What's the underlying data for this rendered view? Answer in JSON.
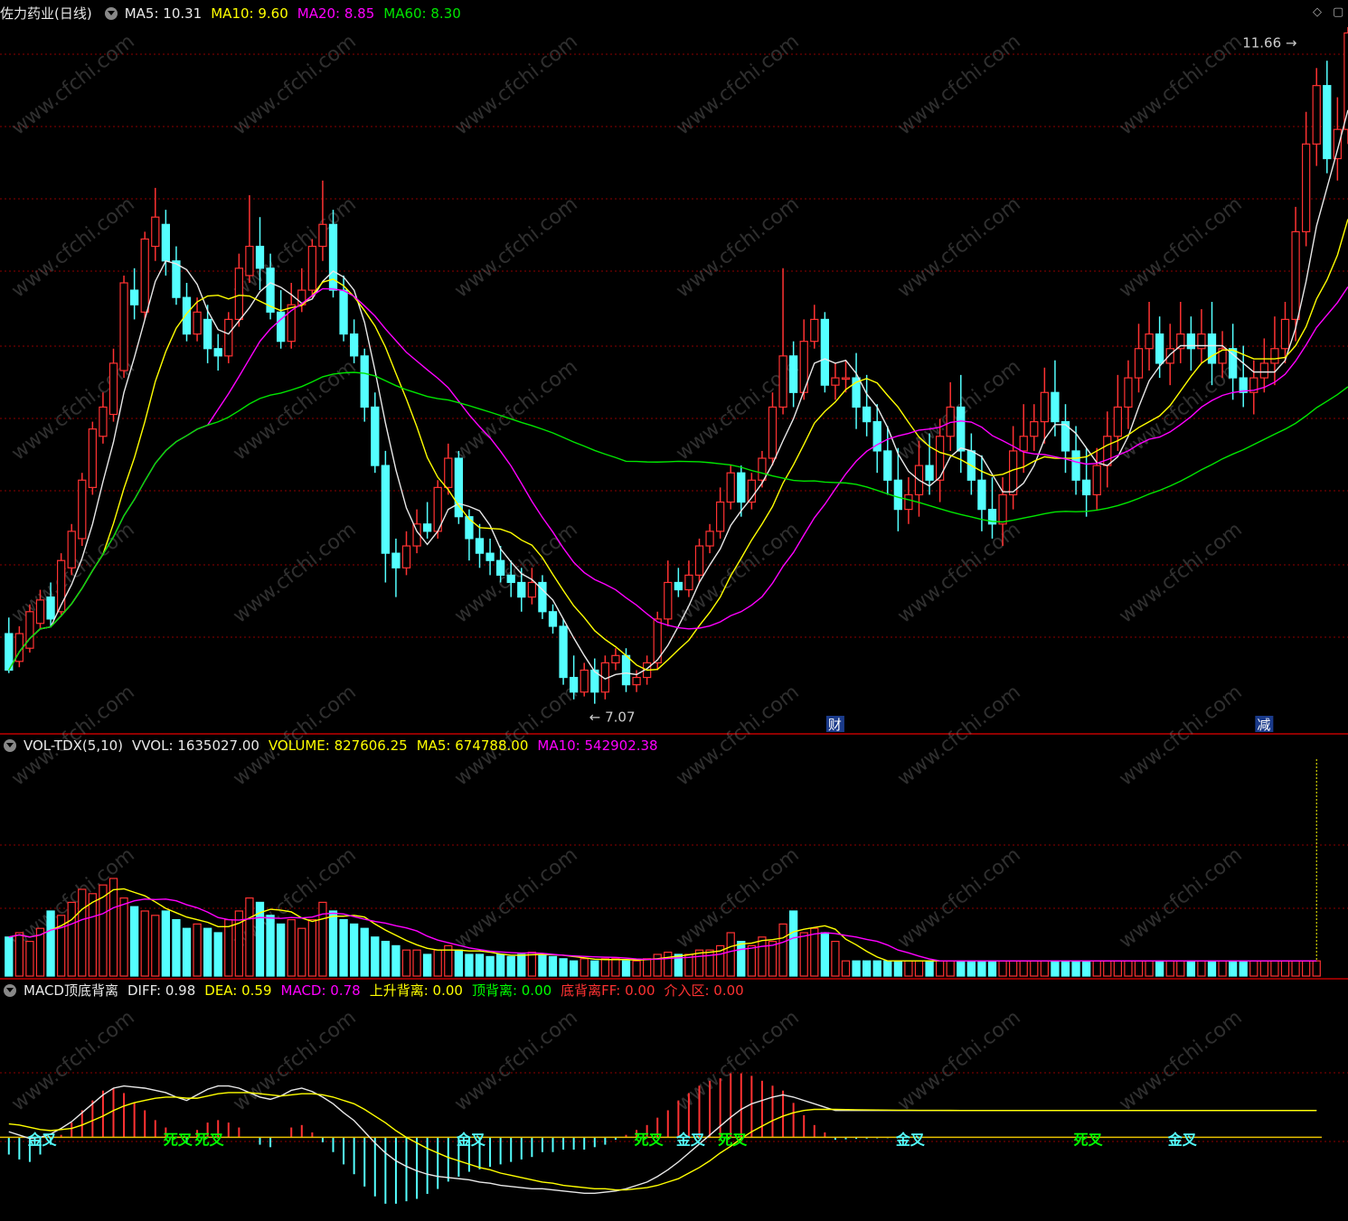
{
  "colors": {
    "up": "#ff3232",
    "down": "#54ffff",
    "ma5": "#e8e8e8",
    "ma10": "#ffff00",
    "ma20": "#ff00ff",
    "ma60": "#00e600",
    "grid": "#8b0000",
    "white": "#e8e8e8",
    "yellow": "#ffff00",
    "magenta": "#ff00ff",
    "green": "#00e600",
    "red": "#ff3232",
    "cyan": "#54ffff",
    "label_gold": "#e8c000",
    "label_cyan": "#54ffff",
    "label_green": "#00ff00"
  },
  "price_header": {
    "title": "佐力药业(日线)",
    "ma5": "MA5: 10.31",
    "ma10": "MA10: 9.60",
    "ma20": "MA20: 8.85",
    "ma60": "MA60: 8.30"
  },
  "vol_header": {
    "name": "VOL-TDX(5,10)",
    "vvol": "VVOL: 1635027.00",
    "volume": "VOLUME: 827606.25",
    "ma5": "MA5: 674788.00",
    "ma10": "MA10: 542902.38"
  },
  "macd_header": {
    "name": "MACD顶底背离",
    "diff": "DIFF: 0.98",
    "dea": "DEA: 0.59",
    "macd": "MACD: 0.78",
    "up_div": "上升背离: 0.00",
    "top_div": "顶背离: 0.00",
    "bottom_div": "底背离FF: 0.00",
    "entry": "介入区: 0.00"
  },
  "corner_icons": [
    "diamond-icon",
    "window-icon"
  ],
  "watermark": "www.cfchi.com",
  "chart_data": {
    "type": "candlestick",
    "x": "trading day index (0-125)",
    "price_range": [
      7.0,
      11.7
    ],
    "high_marker": "11.66",
    "low_marker": "7.07",
    "high_marker_value": 11.66,
    "low_marker_value": 7.07,
    "event_markers": [
      {
        "label": "财",
        "day": 79
      },
      {
        "label": "减",
        "day": 120
      }
    ],
    "candles": [
      [
        7.55,
        7.3,
        7.66,
        7.28
      ],
      [
        7.36,
        7.55,
        7.6,
        7.32
      ],
      [
        7.45,
        7.7,
        7.75,
        7.42
      ],
      [
        7.62,
        7.78,
        7.85,
        7.58
      ],
      [
        7.8,
        7.65,
        7.9,
        7.6
      ],
      [
        7.7,
        8.05,
        8.1,
        7.68
      ],
      [
        8.0,
        8.25,
        8.3,
        7.95
      ],
      [
        8.2,
        8.6,
        8.65,
        8.15
      ],
      [
        8.55,
        8.95,
        9.0,
        8.5
      ],
      [
        8.9,
        9.1,
        9.2,
        8.85
      ],
      [
        9.05,
        9.4,
        9.5,
        9.0
      ],
      [
        9.35,
        9.95,
        10.0,
        9.3
      ],
      [
        9.9,
        9.8,
        10.05,
        9.7
      ],
      [
        9.75,
        10.25,
        10.3,
        9.7
      ],
      [
        10.2,
        10.4,
        10.6,
        10.1
      ],
      [
        10.35,
        10.1,
        10.45,
        10.0
      ],
      [
        10.1,
        9.85,
        10.2,
        9.8
      ],
      [
        9.85,
        9.6,
        9.95,
        9.55
      ],
      [
        9.6,
        9.75,
        9.85,
        9.55
      ],
      [
        9.7,
        9.5,
        9.8,
        9.4
      ],
      [
        9.5,
        9.45,
        9.6,
        9.35
      ],
      [
        9.45,
        9.7,
        9.75,
        9.4
      ],
      [
        9.7,
        10.05,
        10.15,
        9.65
      ],
      [
        10.0,
        10.2,
        10.55,
        9.95
      ],
      [
        10.2,
        10.05,
        10.4,
        9.9
      ],
      [
        10.05,
        9.75,
        10.15,
        9.7
      ],
      [
        9.75,
        9.55,
        9.9,
        9.5
      ],
      [
        9.55,
        9.8,
        9.95,
        9.5
      ],
      [
        9.8,
        9.9,
        10.05,
        9.75
      ],
      [
        9.9,
        10.2,
        10.25,
        9.85
      ],
      [
        10.2,
        10.35,
        10.65,
        10.1
      ],
      [
        10.35,
        9.9,
        10.45,
        9.85
      ],
      [
        9.9,
        9.6,
        10.0,
        9.55
      ],
      [
        9.6,
        9.45,
        9.7,
        9.4
      ],
      [
        9.45,
        9.1,
        9.5,
        9.0
      ],
      [
        9.1,
        8.7,
        9.2,
        8.65
      ],
      [
        8.7,
        8.1,
        8.8,
        7.9
      ],
      [
        8.1,
        8.0,
        8.2,
        7.8
      ],
      [
        8.0,
        8.15,
        8.25,
        7.95
      ],
      [
        8.15,
        8.3,
        8.4,
        8.1
      ],
      [
        8.3,
        8.25,
        8.45,
        8.2
      ],
      [
        8.25,
        8.55,
        8.6,
        8.2
      ],
      [
        8.55,
        8.75,
        8.85,
        8.5
      ],
      [
        8.75,
        8.35,
        8.8,
        8.3
      ],
      [
        8.35,
        8.2,
        8.4,
        8.05
      ],
      [
        8.2,
        8.1,
        8.3,
        8.0
      ],
      [
        8.1,
        8.05,
        8.2,
        7.95
      ],
      [
        8.05,
        7.95,
        8.15,
        7.9
      ],
      [
        7.95,
        7.9,
        8.05,
        7.8
      ],
      [
        7.9,
        7.8,
        8.0,
        7.7
      ],
      [
        7.8,
        7.9,
        8.0,
        7.75
      ],
      [
        7.9,
        7.7,
        7.95,
        7.65
      ],
      [
        7.7,
        7.6,
        7.75,
        7.55
      ],
      [
        7.6,
        7.25,
        7.65,
        7.2
      ],
      [
        7.25,
        7.15,
        7.4,
        7.1
      ],
      [
        7.15,
        7.3,
        7.35,
        7.12
      ],
      [
        7.3,
        7.15,
        7.38,
        7.07
      ],
      [
        7.15,
        7.35,
        7.4,
        7.1
      ],
      [
        7.35,
        7.4,
        7.45,
        7.3
      ],
      [
        7.4,
        7.2,
        7.45,
        7.15
      ],
      [
        7.2,
        7.25,
        7.3,
        7.15
      ],
      [
        7.25,
        7.35,
        7.4,
        7.2
      ],
      [
        7.35,
        7.65,
        7.7,
        7.3
      ],
      [
        7.65,
        7.9,
        8.05,
        7.6
      ],
      [
        7.9,
        7.85,
        8.0,
        7.8
      ],
      [
        7.85,
        7.95,
        8.05,
        7.8
      ],
      [
        7.95,
        8.15,
        8.2,
        7.9
      ],
      [
        8.15,
        8.25,
        8.3,
        8.1
      ],
      [
        8.25,
        8.45,
        8.55,
        8.2
      ],
      [
        8.45,
        8.65,
        8.7,
        8.4
      ],
      [
        8.65,
        8.45,
        8.7,
        8.35
      ],
      [
        8.45,
        8.6,
        8.65,
        8.4
      ],
      [
        8.6,
        8.75,
        8.8,
        8.55
      ],
      [
        8.75,
        9.1,
        9.2,
        8.7
      ],
      [
        9.1,
        9.45,
        10.05,
        9.05
      ],
      [
        9.45,
        9.2,
        9.55,
        9.1
      ],
      [
        9.2,
        9.55,
        9.7,
        9.15
      ],
      [
        9.55,
        9.7,
        9.8,
        9.5
      ],
      [
        9.7,
        9.25,
        9.75,
        9.2
      ],
      [
        9.25,
        9.3,
        9.4,
        9.15
      ]
    ],
    "volume": [
      0.18,
      0.2,
      0.16,
      0.22,
      0.3,
      0.28,
      0.34,
      0.4,
      0.38,
      0.42,
      0.45,
      0.36,
      0.32,
      0.3,
      0.28,
      0.3,
      0.26,
      0.22,
      0.24,
      0.22,
      0.2,
      0.26,
      0.3,
      0.36,
      0.34,
      0.28,
      0.24,
      0.26,
      0.22,
      0.26,
      0.34,
      0.3,
      0.26,
      0.24,
      0.22,
      0.18,
      0.16,
      0.14,
      0.12,
      0.12,
      0.1,
      0.12,
      0.14,
      0.12,
      0.1,
      0.1,
      0.09,
      0.1,
      0.09,
      0.1,
      0.11,
      0.1,
      0.09,
      0.08,
      0.07,
      0.08,
      0.07,
      0.08,
      0.08,
      0.07,
      0.07,
      0.08,
      0.1,
      0.11,
      0.1,
      0.1,
      0.12,
      0.12,
      0.14,
      0.2,
      0.16,
      0.14,
      0.18,
      0.16,
      0.24,
      0.3,
      0.2,
      0.22,
      0.2,
      0.16
    ],
    "macd_range": [
      -0.7,
      1.2
    ],
    "diff": [
      0.05,
      0.02,
      -0.01,
      0.0,
      0.03,
      0.08,
      0.14,
      0.22,
      0.3,
      0.38,
      0.44,
      0.46,
      0.45,
      0.44,
      0.42,
      0.4,
      0.36,
      0.33,
      0.38,
      0.43,
      0.46,
      0.46,
      0.44,
      0.4,
      0.36,
      0.34,
      0.37,
      0.42,
      0.44,
      0.41,
      0.36,
      0.3,
      0.22,
      0.15,
      0.05,
      -0.05,
      -0.14,
      -0.21,
      -0.26,
      -0.3,
      -0.33,
      -0.35,
      -0.36,
      -0.37,
      -0.38,
      -0.4,
      -0.41,
      -0.43,
      -0.44,
      -0.45,
      -0.46,
      -0.46,
      -0.47,
      -0.48,
      -0.49,
      -0.5,
      -0.5,
      -0.49,
      -0.48,
      -0.46,
      -0.43,
      -0.4,
      -0.35,
      -0.29,
      -0.22,
      -0.14,
      -0.06,
      0.02,
      0.1,
      0.18,
      0.25,
      0.3,
      0.33,
      0.36,
      0.38,
      0.36,
      0.33,
      0.3,
      0.27,
      0.24
    ],
    "dea": [
      0.12,
      0.11,
      0.09,
      0.07,
      0.06,
      0.07,
      0.08,
      0.11,
      0.15,
      0.19,
      0.24,
      0.28,
      0.31,
      0.33,
      0.35,
      0.36,
      0.36,
      0.35,
      0.35,
      0.37,
      0.39,
      0.4,
      0.4,
      0.4,
      0.39,
      0.38,
      0.37,
      0.38,
      0.39,
      0.39,
      0.38,
      0.36,
      0.33,
      0.3,
      0.25,
      0.19,
      0.13,
      0.06,
      0.0,
      -0.05,
      -0.1,
      -0.14,
      -0.18,
      -0.21,
      -0.24,
      -0.27,
      -0.29,
      -0.32,
      -0.34,
      -0.36,
      -0.38,
      -0.4,
      -0.41,
      -0.43,
      -0.44,
      -0.45,
      -0.46,
      -0.46,
      -0.47,
      -0.47,
      -0.46,
      -0.45,
      -0.43,
      -0.4,
      -0.37,
      -0.32,
      -0.27,
      -0.21,
      -0.14,
      -0.08,
      -0.01,
      0.05,
      0.1,
      0.15,
      0.19,
      0.22,
      0.24,
      0.25,
      0.25,
      0.25
    ],
    "macd_labels": [
      {
        "label": "金叉",
        "day": 3,
        "color": "cyan"
      },
      {
        "label": "死叉",
        "day": 16,
        "color": "green"
      },
      {
        "label": "死叉",
        "day": 19,
        "color": "green"
      },
      {
        "label": "金叉",
        "day": 44,
        "color": "cyan"
      },
      {
        "label": "死叉",
        "day": 61,
        "color": "green"
      },
      {
        "label": "金叉",
        "day": 65,
        "color": "cyan"
      },
      {
        "label": "死叉",
        "day": 69,
        "color": "green"
      },
      {
        "label": "金叉",
        "day": 86,
        "color": "cyan"
      },
      {
        "label": "死叉",
        "day": 103,
        "color": "green"
      },
      {
        "label": "金叉",
        "day": 112,
        "color": "cyan"
      }
    ]
  }
}
